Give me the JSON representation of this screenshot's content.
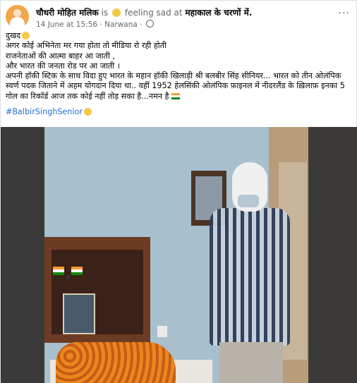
{
  "post": {
    "author": "चौधरी मोहित मलिक",
    "feeling_prefix": "is",
    "feeling": "feeling sad at",
    "location": "महाकाल के चरणों में.",
    "time": "14 June at 15:56",
    "separator": "·",
    "place": "Narwana",
    "dot2": "·",
    "more": "···"
  },
  "text": {
    "line1": "दुखद",
    "line2": "अगर कोई अभिनेता मर गया होता तो मीडिया रो रही होती",
    "line3": "राजनेताओं की आत्मा बाहर आ जाती ,",
    "line4": "और भारत की जनता रोड पर आ जाती ।",
    "line5": "अपनी हॉकी स्टिक के साथ विदा हुए भारत के महान हॉकी खिलाड़ी श्री बलबीर सिंह सीनियर... भारत को तीन ओलंपिक स्वर्ण पदक जिताने में अहम योगदान दिया था.. वहीं 1952 हेलसिंकी ओलंपिक फ़ाइनल में नीदरलैंड के ख़िलाफ़ इनका 5 गोल का रिकॉर्ड आज तक कोई नहीं तोड़ सका है...नमन है",
    "hashtag": "#BalbirSinghSenior"
  },
  "icons": {
    "avatar": "profile-avatar",
    "feeling": "sad-face-icon",
    "privacy": "globe-icon",
    "flag": "india-flag-icon"
  },
  "colors": {
    "link": "#216fdb",
    "muted": "#65676b"
  }
}
